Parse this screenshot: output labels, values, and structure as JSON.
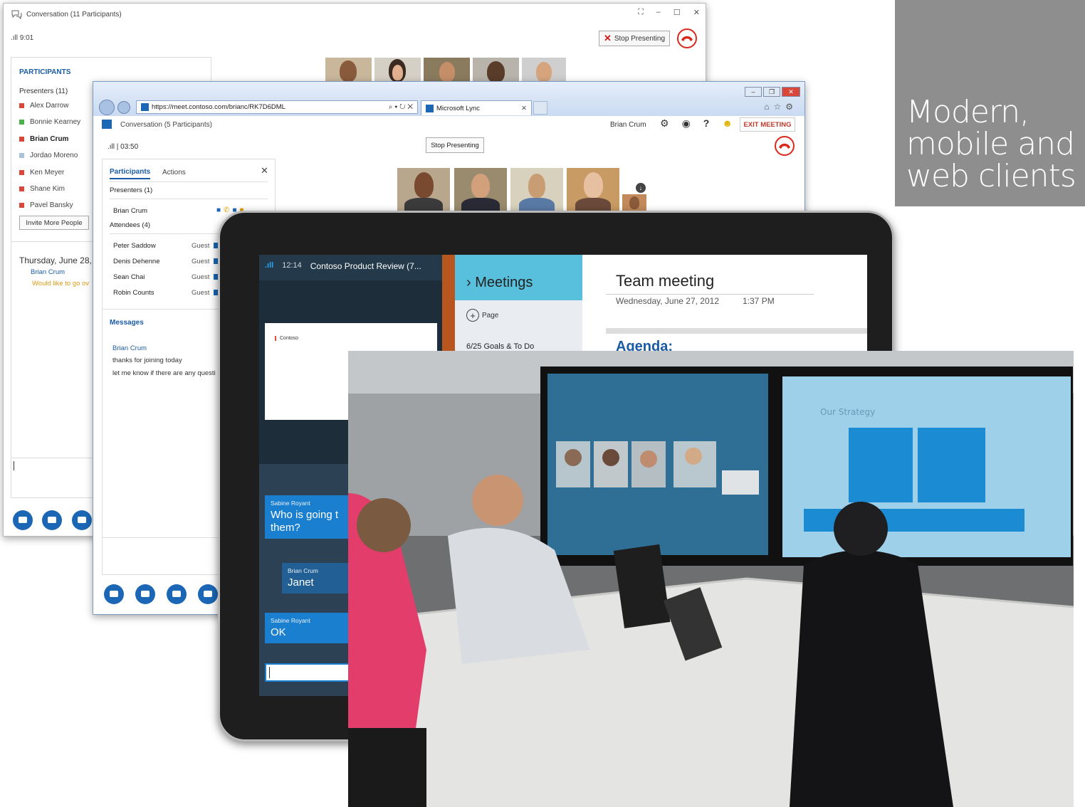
{
  "desktop_window": {
    "title": "Conversation (11 Participants)",
    "signal_time": "9:01",
    "stop_presenting": "Stop Presenting",
    "participants_heading": "PARTICIPANTS",
    "presenters_label": "Presenters (11)",
    "presenters": [
      {
        "name": "Alex Darrow",
        "status_color": "#d9463a",
        "bold": false
      },
      {
        "name": "Bonnie Kearney",
        "status_color": "#4ab04a",
        "bold": false
      },
      {
        "name": "Brian Crum",
        "status_color": "#d9463a",
        "bold": true
      },
      {
        "name": "Jordao Moreno",
        "status_color": "#a8c3d8",
        "bold": false
      },
      {
        "name": "Ken Meyer",
        "status_color": "#d9463a",
        "bold": false
      },
      {
        "name": "Shane Kim",
        "status_color": "#d9463a",
        "bold": false
      },
      {
        "name": "Pavel Bansky",
        "status_color": "#d9463a",
        "bold": false
      }
    ],
    "invite_button": "Invite More People",
    "conversation_date": "Thursday, June 28, 2",
    "conversation_sender": "Brian Crum",
    "conversation_message": "Would like to go ov"
  },
  "web_window": {
    "url": "https://meet.contoso.com/brianc/RK7D6DML",
    "tab_title": "Microsoft Lync",
    "conversation_title": "Conversation (5 Participants)",
    "user_name": "Brian Crum",
    "exit_meeting": "EXIT MEETING",
    "signal_time": "03:50",
    "stop_presenting": "Stop Presenting",
    "tabs": {
      "participants": "Participants",
      "actions": "Actions"
    },
    "presenters_label": "Presenters (1)",
    "presenter": "Brian Crum",
    "attendees_label": "Attendees (4)",
    "attendees": [
      {
        "name": "Peter Saddow",
        "role": "Guest"
      },
      {
        "name": "Denis Dehenne",
        "role": "Guest"
      },
      {
        "name": "Sean Chai",
        "role": "Guest"
      },
      {
        "name": "Robin Counts",
        "role": "Guest"
      }
    ],
    "messages_heading": "Messages",
    "message_sender": "Brian Crum",
    "messages": [
      "thanks for joining today",
      "let me know if there are any questi"
    ]
  },
  "tablet": {
    "time": "12:14",
    "meeting_title": "Contoso Product Review (7...",
    "slide_brand": "Contoso",
    "chat": [
      {
        "sender": "Sabine Royant",
        "text_line1": "Who is going t",
        "text_line2": "them?"
      },
      {
        "sender": "Brian Crum",
        "text_line1": "Janet",
        "text_line2": ""
      },
      {
        "sender": "Sabine Royant",
        "text_line1": "OK",
        "text_line2": ""
      }
    ],
    "notebook_section": "› Meetings",
    "add_page": "Page",
    "page_item": "6/25 Goals & To Do",
    "note_title": "Team meeting",
    "note_date": "Wednesday, June 27, 2012",
    "note_time": "1:37 PM",
    "agenda": "Agenda:"
  },
  "photo": {
    "screen_text": "Our Strategy"
  },
  "tile": {
    "line1": "Modern,",
    "line2": "mobile and",
    "line3": "web clients"
  }
}
